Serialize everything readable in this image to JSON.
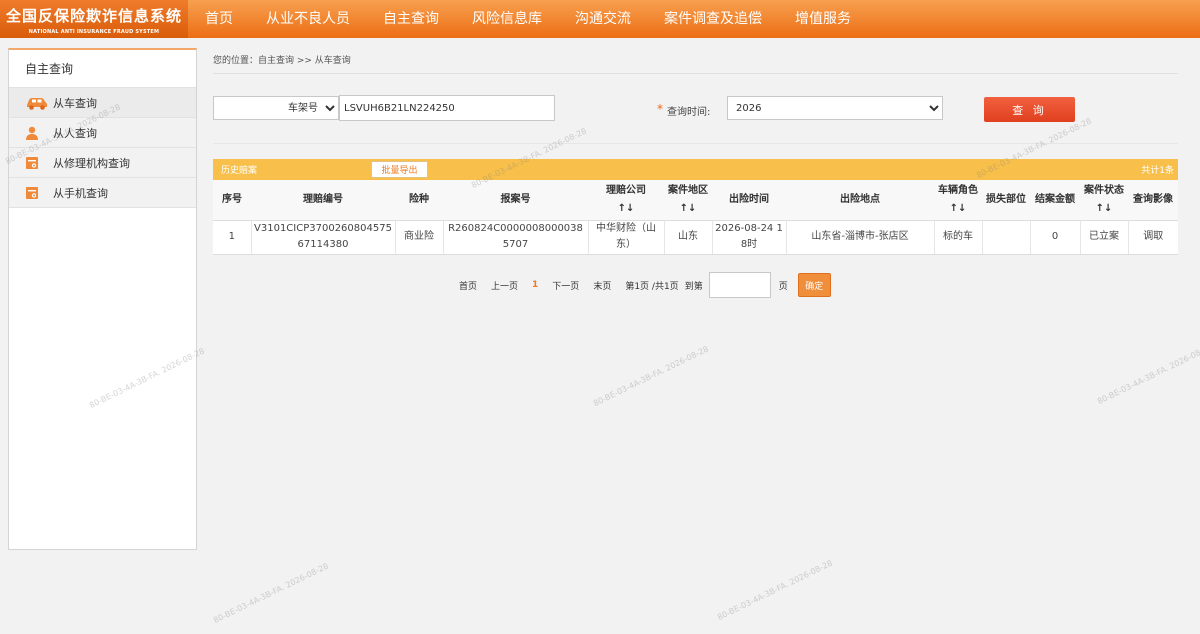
{
  "app": {
    "title_cn": "全国反保险欺诈信息系统",
    "title_en": "NATIONAL ANTI INSURANCE FRAUD SYSTEM",
    "brand_color": "#ec6e14"
  },
  "nav": [
    "首页",
    "从业不良人员",
    "自主查询",
    "风险信息库",
    "沟通交流",
    "案件调查及追偿",
    "增值服务"
  ],
  "sidebar": {
    "title": "自主查询",
    "items": [
      {
        "label": "从车查询",
        "icon": "car-icon",
        "active": true
      },
      {
        "label": "从人查询",
        "icon": "person-icon",
        "active": false
      },
      {
        "label": "从修理机构查询",
        "icon": "repair-shop-icon",
        "active": false
      },
      {
        "label": "从手机查询",
        "icon": "phone-icon",
        "active": false
      }
    ]
  },
  "breadcrumb": "您的位置：自主查询 >> 从车查询",
  "search": {
    "type_selected": "车架号",
    "vin_value": "LSVUH6B21LN224250",
    "required_mark": "*",
    "time_label": "查询时间:",
    "time_selected": "2026",
    "submit_label": "查 询"
  },
  "results": {
    "section_title": "历史赔案",
    "export_label": "批量导出",
    "count_label": "共计1条",
    "columns": [
      {
        "label": "序号",
        "sortable": false
      },
      {
        "label": "理赔编号",
        "sortable": false
      },
      {
        "label": "险种",
        "sortable": false
      },
      {
        "label": "报案号",
        "sortable": false
      },
      {
        "label": "理赔公司",
        "sortable": true
      },
      {
        "label": "案件地区",
        "sortable": true
      },
      {
        "label": "出险时间",
        "sortable": false
      },
      {
        "label": "出险地点",
        "sortable": false
      },
      {
        "label": "车辆角色",
        "sortable": true
      },
      {
        "label": "损失部位",
        "sortable": false
      },
      {
        "label": "结案金额",
        "sortable": false
      },
      {
        "label": "案件状态",
        "sortable": true
      },
      {
        "label": "查询影像",
        "sortable": false
      }
    ],
    "rows": [
      [
        "1",
        "V3101CICP370026080457567114380",
        "商业险",
        "R260824C00000080000385707",
        "中华财险（山东）",
        "山东",
        "2026-08-24 18时",
        "山东省-淄博市-张店区",
        "标的车",
        "",
        "0",
        "已立案",
        "调取"
      ]
    ]
  },
  "pager": {
    "first": "首页",
    "prev": "上一页",
    "current": "1",
    "next": "下一页",
    "last": "末页",
    "info": "第1页 /共1页",
    "goto_label": "到第",
    "page_unit": "页",
    "confirm": "确定"
  },
  "watermark": "80-BE-03-4A-3B-FA. 2026-08-28"
}
